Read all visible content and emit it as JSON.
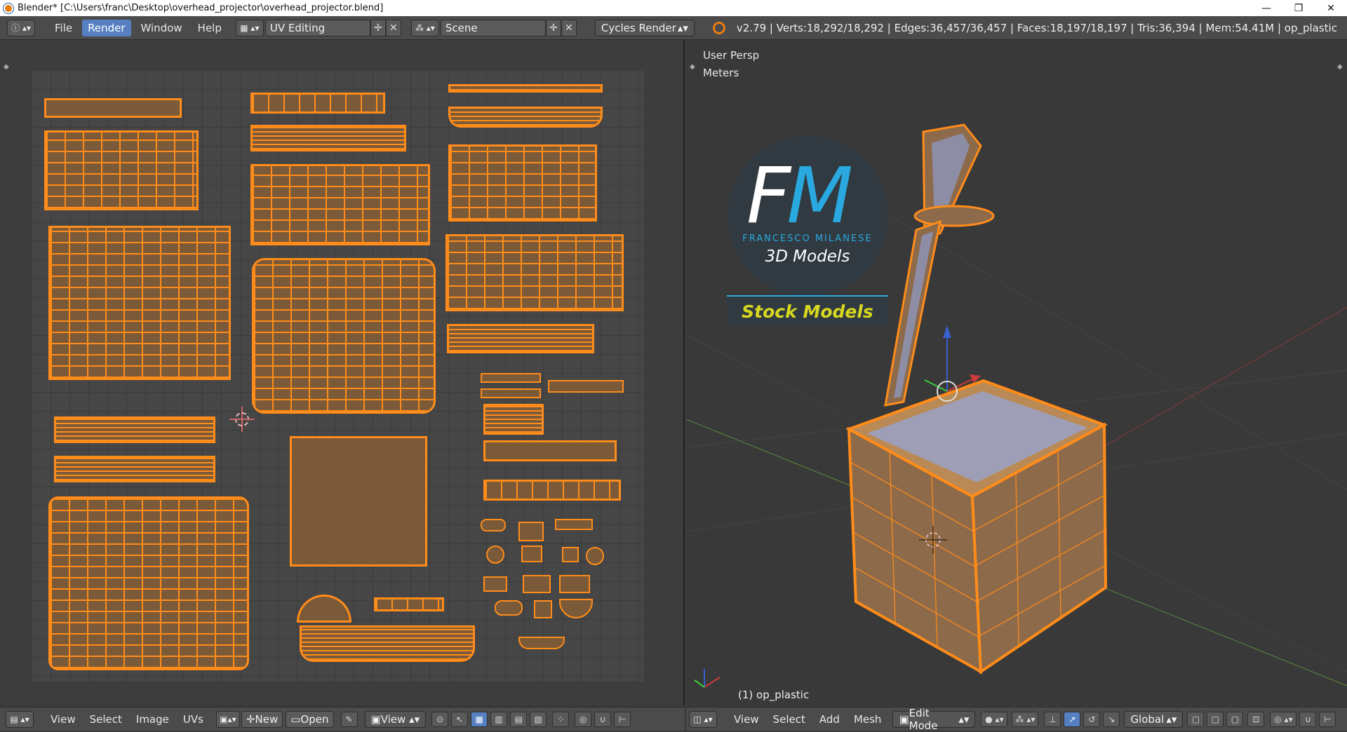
{
  "titlebar": {
    "title": "Blender* [C:\\Users\\franc\\Desktop\\overhead_projector\\overhead_projector.blend]",
    "minimize": "—",
    "restore": "❐",
    "close": "✕"
  },
  "infobar": {
    "menus": [
      "File",
      "Render",
      "Window",
      "Help"
    ],
    "active_menu": "Render",
    "screen_layout": "UV Editing",
    "scene": "Scene",
    "render_engine": "Cycles Render",
    "stats": "v2.79 | Verts:18,292/18,292 | Edges:36,457/36,457 | Faces:18,197/18,197 | Tris:36,394 | Mem:54.41M | op_plastic"
  },
  "view3d": {
    "perspective": "User Persp",
    "units": "Meters",
    "object_label": "(1) op_plastic",
    "logo": {
      "initials_f": "F",
      "initials_m": "M",
      "name": "FRANCESCO MILANESE",
      "subtitle": "3D Models",
      "banner": "Stock Models"
    }
  },
  "uv_footer": {
    "menus": [
      "View",
      "Select",
      "Image",
      "UVs"
    ],
    "new_label": "New",
    "open_label": "Open",
    "view_label": "View"
  },
  "view3d_footer": {
    "menus": [
      "View",
      "Select",
      "Add",
      "Mesh"
    ],
    "mode": "Edit Mode",
    "orientation": "Global"
  },
  "colors": {
    "accent_blue": "#5680c2",
    "uv_orange": "#ff8c1a",
    "logo_blue": "#2aa8e0",
    "banner_yellow": "#d8d820"
  }
}
